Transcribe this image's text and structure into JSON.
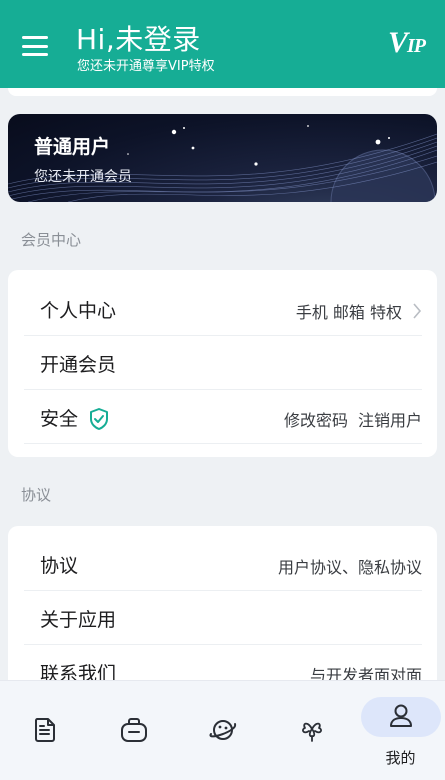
{
  "header": {
    "title": "Hi,未登录",
    "subtitle": "您还未开通尊享VIP特权",
    "vip_logo": "VIP",
    "bg_color": "#16ad95",
    "menu_icon": "hamburger-menu-icon"
  },
  "banner": {
    "title": "普通用户",
    "subtitle": "您还未开通会员"
  },
  "member_section": {
    "label": "会员中心",
    "rows": [
      {
        "title": "个人中心",
        "right": "手机 邮箱 特权",
        "has_chevron": true
      },
      {
        "title": "开通会员",
        "right": ""
      },
      {
        "title": "安全",
        "right_items": [
          "修改密码",
          "注销用户"
        ],
        "icon": "shield-check-icon"
      }
    ]
  },
  "agreement_section": {
    "label": "协议",
    "rows": [
      {
        "title": "协议",
        "right": "用户协议、隐私协议"
      },
      {
        "title": "关于应用",
        "right": ""
      },
      {
        "title": "联系我们",
        "right": "与开发者面对面"
      }
    ]
  },
  "bottom_nav": {
    "items": [
      {
        "icon": "document-icon",
        "label": ""
      },
      {
        "icon": "lunchbox-icon",
        "label": ""
      },
      {
        "icon": "planet-icon",
        "label": ""
      },
      {
        "icon": "clover-icon",
        "label": ""
      },
      {
        "icon": "user-icon",
        "label": "我的",
        "active": true
      }
    ]
  }
}
